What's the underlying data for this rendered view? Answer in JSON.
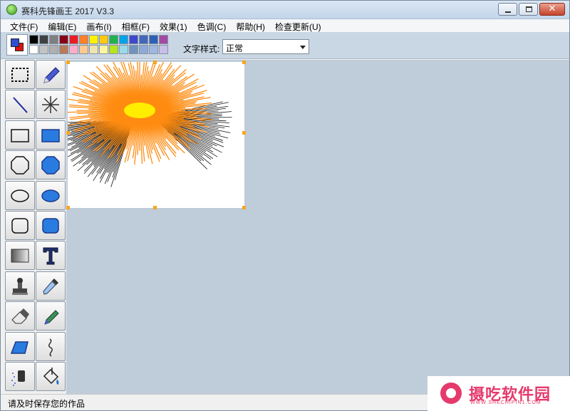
{
  "window": {
    "title": "赛科先锋画王 2017 V3.3",
    "controls": {
      "minimize": "",
      "maximize": "",
      "close": "✕"
    }
  },
  "menu": {
    "items": [
      "文件(F)",
      "编辑(E)",
      "画布(I)",
      "相框(F)",
      "效果(1)",
      "色调(C)",
      "帮助(H)",
      "检查更新(U)"
    ]
  },
  "toolbar": {
    "foreground_color": "#2f4fd0",
    "background_color": "#e01010",
    "palette": [
      "#000000",
      "#404040",
      "#7f7f7f",
      "#880015",
      "#ed1c24",
      "#ff7f27",
      "#fff200",
      "#ffc90e",
      "#22b14c",
      "#00a2e8",
      "#3f48cc",
      "#4366b8",
      "#2d5fb5",
      "#a349a4",
      "#ffffff",
      "#c3c3c3",
      "#b0b0b0",
      "#b97a57",
      "#ffaec9",
      "#ffc990",
      "#efe4b0",
      "#fff5a0",
      "#b5e61d",
      "#99d9ea",
      "#7092be",
      "#8ea9d8",
      "#9db7e0",
      "#c8bfe7"
    ],
    "text_style_label": "文字样式:",
    "text_style_value": "正常"
  },
  "tools": [
    {
      "name": "rect-select-tool",
      "icon": "dashed-rect-icon"
    },
    {
      "name": "pencil-tool",
      "icon": "pencil-icon"
    },
    {
      "name": "line-tool",
      "icon": "line-icon"
    },
    {
      "name": "radial-line-tool",
      "icon": "starburst-icon"
    },
    {
      "name": "rectangle-tool",
      "icon": "rectangle-outline-icon"
    },
    {
      "name": "filled-rectangle-tool",
      "icon": "rectangle-filled-icon"
    },
    {
      "name": "octagon-tool",
      "icon": "octagon-outline-icon"
    },
    {
      "name": "filled-octagon-tool",
      "icon": "octagon-filled-icon"
    },
    {
      "name": "ellipse-tool",
      "icon": "ellipse-outline-icon"
    },
    {
      "name": "filled-ellipse-tool",
      "icon": "ellipse-filled-icon"
    },
    {
      "name": "rounded-rect-tool",
      "icon": "rounded-rect-outline-icon"
    },
    {
      "name": "filled-rounded-rect-tool",
      "icon": "rounded-rect-filled-icon"
    },
    {
      "name": "gradient-tool",
      "icon": "gradient-icon"
    },
    {
      "name": "text-tool",
      "icon": "text-t-icon"
    },
    {
      "name": "stamp-tool",
      "icon": "stamp-icon"
    },
    {
      "name": "eyedropper-tool",
      "icon": "eyedropper-icon"
    },
    {
      "name": "eraser-tool",
      "icon": "eraser-icon"
    },
    {
      "name": "marker-tool",
      "icon": "marker-icon"
    },
    {
      "name": "parallelogram-tool",
      "icon": "parallelogram-icon"
    },
    {
      "name": "curve-tool",
      "icon": "curve-icon"
    },
    {
      "name": "spray-tool",
      "icon": "spray-icon"
    },
    {
      "name": "fill-bucket-tool",
      "icon": "paint-bucket-icon"
    }
  ],
  "status": {
    "text": "请及时保存您的作品"
  },
  "watermark": {
    "title": "摄吃软件园",
    "subtitle": "WWW.SHECHIPIN1.COM"
  }
}
